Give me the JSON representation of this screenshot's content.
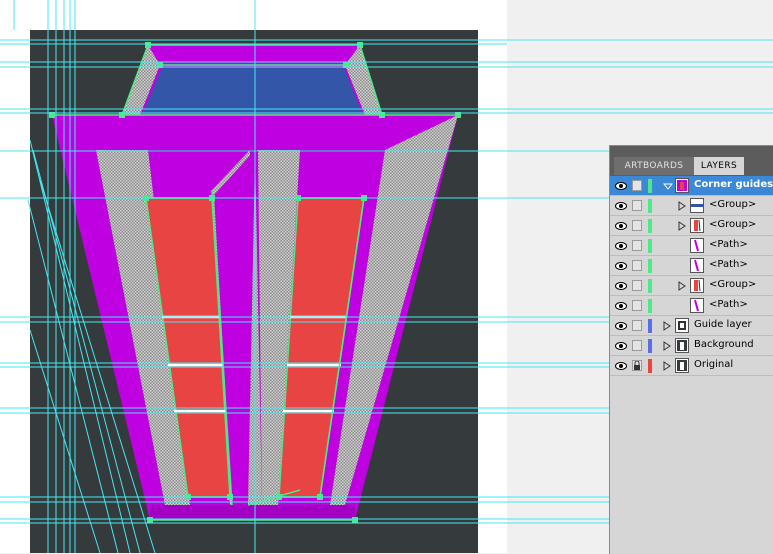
{
  "colors": {
    "artboard_bg": "#353b3d",
    "outer_frame": "#ffffff",
    "magenta": "#bf00e0",
    "red": "#e84444",
    "blue_window": "#3456a8",
    "guide": "#44e8f0",
    "path_green": "#4ee888",
    "halftone": "#b0b0b0",
    "selection": "#3a88d6"
  },
  "panel": {
    "tabs": [
      {
        "label": "ARTBOARDS",
        "active": false
      },
      {
        "label": "LAYERS",
        "active": true
      }
    ],
    "layers": [
      {
        "name": "Corner guides",
        "selected": true,
        "expanded": true,
        "indent": 0,
        "color": "#4ee888",
        "thumb": "magenta",
        "locked": false
      },
      {
        "name": "<Group>",
        "selected": false,
        "expanded": false,
        "indent": 1,
        "color": "#4ee888",
        "thumb": "bar",
        "locked": false
      },
      {
        "name": "<Group>",
        "selected": false,
        "expanded": false,
        "indent": 1,
        "color": "#4ee888",
        "thumb": "red",
        "locked": false
      },
      {
        "name": "<Path>",
        "selected": false,
        "expanded": null,
        "indent": 1,
        "color": "#4ee888",
        "thumb": "magenta-line",
        "locked": false
      },
      {
        "name": "<Path>",
        "selected": false,
        "expanded": null,
        "indent": 1,
        "color": "#4ee888",
        "thumb": "magenta-line",
        "locked": false
      },
      {
        "name": "<Group>",
        "selected": false,
        "expanded": false,
        "indent": 1,
        "color": "#4ee888",
        "thumb": "red",
        "locked": false
      },
      {
        "name": "<Path>",
        "selected": false,
        "expanded": null,
        "indent": 1,
        "color": "#4ee888",
        "thumb": "magenta-line",
        "locked": false
      },
      {
        "name": "Guide layer",
        "selected": false,
        "expanded": false,
        "indent": 0,
        "color": "#5a6ee8",
        "thumb": "tower",
        "locked": false
      },
      {
        "name": "Background",
        "selected": false,
        "expanded": false,
        "indent": 0,
        "color": "#5a6ee8",
        "thumb": "dark",
        "locked": false
      },
      {
        "name": "Original",
        "selected": false,
        "expanded": false,
        "indent": 0,
        "color": "#e84444",
        "thumb": "dark",
        "locked": true
      }
    ]
  }
}
